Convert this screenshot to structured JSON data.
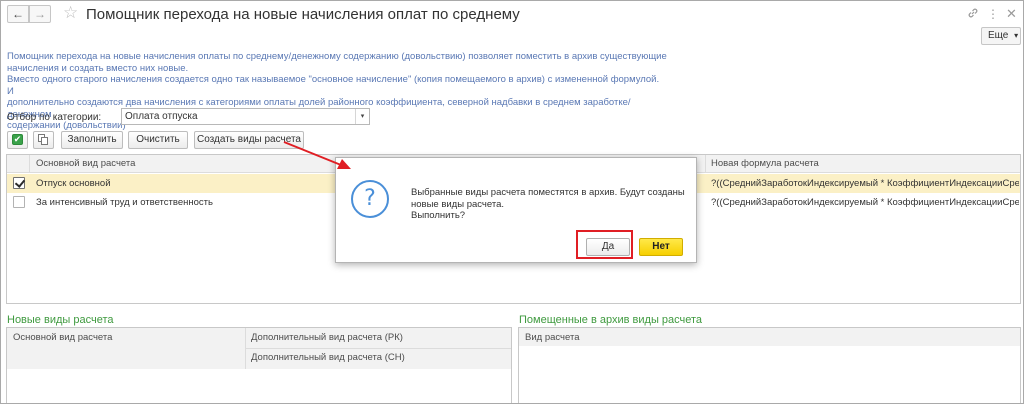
{
  "window": {
    "title": "Помощник перехода на новые начисления оплат по среднему",
    "back_icon": "←",
    "forward_icon": "→",
    "star_icon": "☆",
    "link_icon": "🔗",
    "menu_icon": "⋮",
    "close_icon": "✕"
  },
  "toolbar_more": {
    "label": "Еще",
    "caret": "▾"
  },
  "description": [
    "Помощник перехода на новые начисления оплаты по среднему/денежному содержанию (довольствию) позволяет поместить в архив существующие",
    "начисления и создать вместо них новые.",
    "Вместо одного старого начисления создается одно так называемое \"основное начисление\" (копия помещаемого в архив) с измененной формулой. И",
    "дополнительно создаются два начисления с категориями оплаты долей районного коэффициента, северной надбавки в среднем заработке/денежном",
    "содержании (довольствии)"
  ],
  "filter": {
    "label": "Отбор по категории:",
    "value": "Оплата отпуска",
    "dropdown_icon": "▾"
  },
  "buttons": {
    "check_all_icon": "✔",
    "fill": "Заполнить",
    "clear": "Очистить",
    "create": "Создать виды расчета"
  },
  "main_table": {
    "columns": [
      "Основной вид расчета",
      "Новая формула расчета"
    ],
    "rows": [
      {
        "checked": true,
        "name": "Отпуск основной",
        "formula": "?((СреднийЗаработокИндексируемый * КоэффициентИндексацииСред..."
      },
      {
        "checked": false,
        "name": "За интенсивный труд и ответственность",
        "formula": "?((СреднийЗаработокИндексируемый * КоэффициентИндексацииСред..."
      }
    ]
  },
  "new_types": {
    "title": "Новые виды расчета",
    "col_main": "Основной вид расчета",
    "col_rk": "Дополнительный вид расчета (РК)",
    "col_sn": "Дополнительный вид расчета (СН)"
  },
  "archived_types": {
    "title": "Помещенные в архив виды расчета",
    "col_type": "Вид расчета"
  },
  "dialog": {
    "icon": "?",
    "message": [
      "Выбранные виды расчета поместятся в архив. Будут созданы",
      "новые виды расчета.",
      "Выполнить?"
    ],
    "yes": "Да",
    "no": "Нет"
  },
  "colors": {
    "accent_green": "#3f9a3f",
    "description_blue": "#5a78b4",
    "selected_row": "#fbf0c6",
    "annotation_red": "#e01e24",
    "no_button_yellow": "#f6cf00"
  }
}
